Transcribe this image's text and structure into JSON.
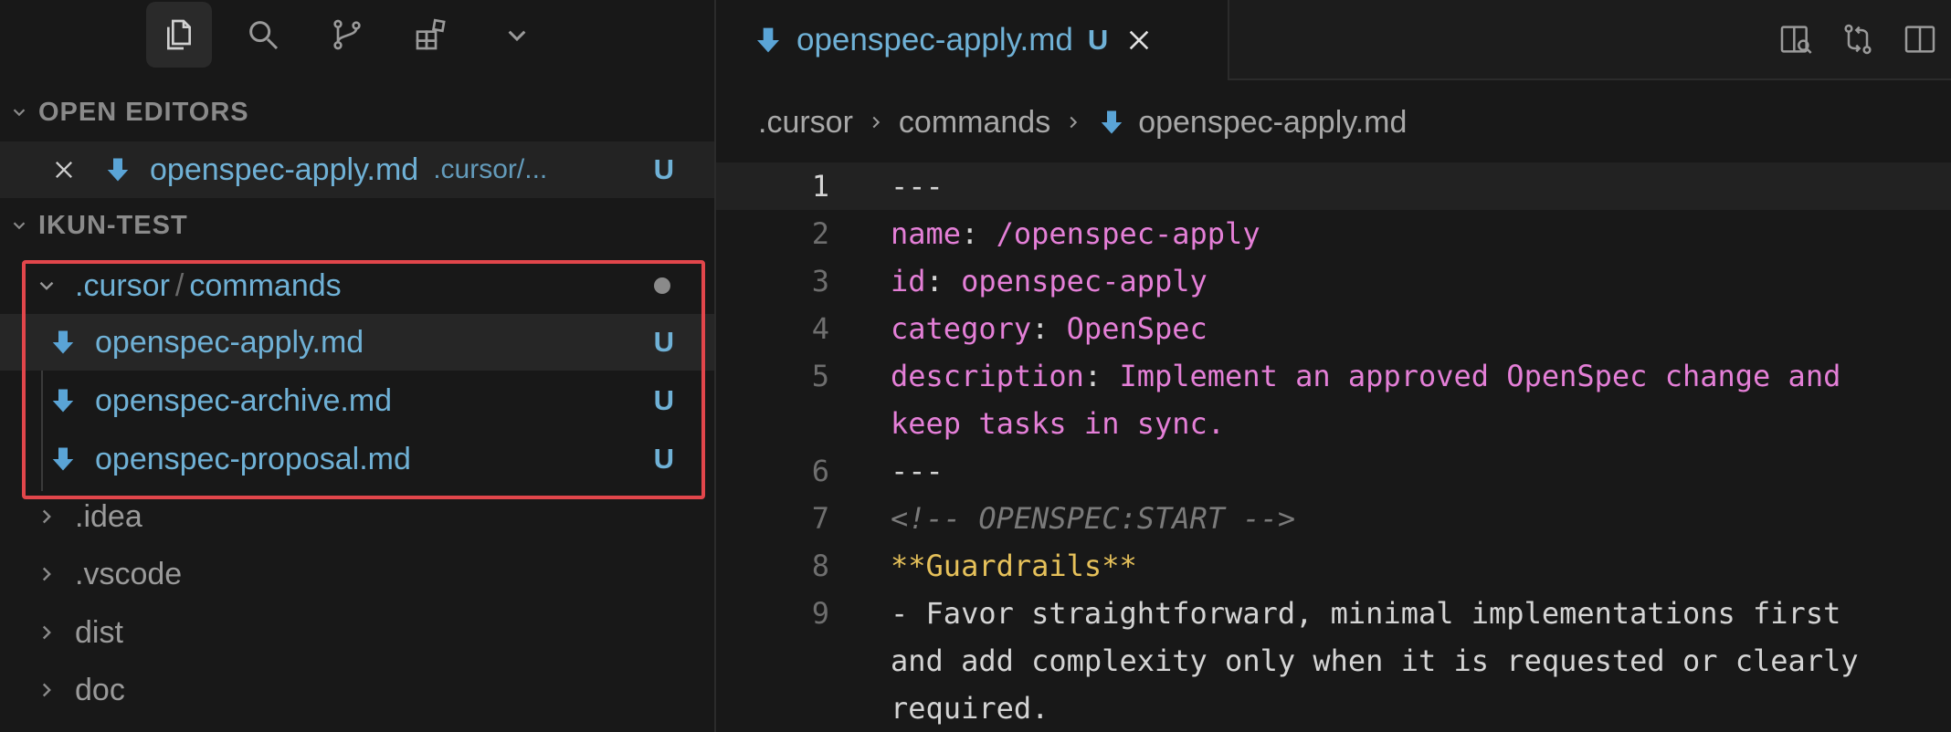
{
  "sidebar": {
    "activity_icons": [
      "explorer-icon",
      "search-icon",
      "source-control-icon",
      "extensions-icon",
      "chevron-down-icon"
    ],
    "open_editors": {
      "header": "OPEN EDITORS",
      "items": [
        {
          "name": "openspec-apply.md",
          "path": ".cursor/...",
          "status": "U"
        }
      ]
    },
    "workspace": {
      "header": "IKUN-TEST",
      "folder_prefix": ".cursor",
      "folder_sep": "/",
      "folder_name": "commands",
      "files": [
        {
          "name": "openspec-apply.md",
          "status": "U"
        },
        {
          "name": "openspec-archive.md",
          "status": "U"
        },
        {
          "name": "openspec-proposal.md",
          "status": "U"
        }
      ],
      "folders": [
        ".idea",
        ".vscode",
        "dist",
        "doc"
      ]
    }
  },
  "editor": {
    "tab": {
      "label": "openspec-apply.md",
      "status": "U"
    },
    "breadcrumb": [
      ".cursor",
      "commands",
      "openspec-apply.md"
    ],
    "lines": [
      {
        "n": "1"
      },
      {
        "n": "2"
      },
      {
        "n": "3"
      },
      {
        "n": "4"
      },
      {
        "n": "5"
      },
      {
        "n": ""
      },
      {
        "n": "6"
      },
      {
        "n": "7"
      },
      {
        "n": "8"
      },
      {
        "n": "9"
      },
      {
        "n": ""
      },
      {
        "n": ""
      }
    ],
    "code": {
      "l1": "---",
      "l2k": "name",
      "l2v": "/openspec-apply",
      "l3k": "id",
      "l3v": "openspec-apply",
      "l4k": "category",
      "l4v": "OpenSpec",
      "l5k": "description",
      "l5v": "Implement an approved OpenSpec change and",
      "l5b": "keep tasks in sync.",
      "l6": "---",
      "l7": "<!-- OPENSPEC:START -->",
      "l8": "**Guardrails**",
      "l9a": "- Favor straightforward, minimal implementations first",
      "l9b": "and add complexity only when it is requested or clearly",
      "l9c": "required.",
      "colon": ":"
    }
  },
  "colors": {
    "accent": "#6fb1d6",
    "highlight": "#e2464b",
    "key": "#e47fd7",
    "bold": "#e6c15a"
  }
}
